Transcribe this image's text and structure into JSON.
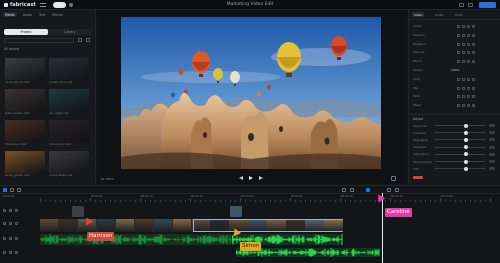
{
  "app": {
    "logo": "fabricast",
    "project_title": "Marketing Video Edit"
  },
  "left_panel": {
    "tabs": [
      "Media",
      "Audio",
      "Text",
      "Effects"
    ],
    "active_tab": 0,
    "segment": {
      "on": "Project",
      "off": "Library"
    },
    "section_title": "All media",
    "thumbs": [
      {
        "caption": "landscape_01.mp4",
        "bg": "#3a3d3f"
      },
      {
        "caption": "sunset_drive.mp4",
        "bg": "#2a2f36"
      },
      {
        "caption": "skate_session.mp4",
        "bg": "#3b3430"
      },
      {
        "caption": "city_night.mp4",
        "bg": "#1e3b40"
      },
      {
        "caption": "interview_a.mp4",
        "bg": "#4a2c24"
      },
      {
        "caption": "interview_b.mp4",
        "bg": "#2a2226"
      },
      {
        "caption": "beach_golden.mp4",
        "bg": "#7a5226"
      },
      {
        "caption": "crowd_street.mp4",
        "bg": "#3c3a3a"
      }
    ]
  },
  "preview": {
    "scale_label": "Fit 100%",
    "accent": "#2f6fd6"
  },
  "right_panel": {
    "tabs": [
      "Video",
      "Audio",
      "Color"
    ],
    "active_tab": 0,
    "props": [
      {
        "key": "Scale",
        "val": ""
      },
      {
        "key": "Position",
        "val": ""
      },
      {
        "key": "Rotation",
        "val": ""
      },
      {
        "key": "Opacity",
        "val": ""
      },
      {
        "key": "Blend",
        "val": ""
      },
      {
        "key": "Speed",
        "val": "100%"
      },
      {
        "key": "Crop",
        "val": ""
      },
      {
        "key": "Flip",
        "val": ""
      },
      {
        "key": "Fade",
        "val": ""
      },
      {
        "key": "Mask",
        "val": ""
      }
    ],
    "adjust_title": "Adjust",
    "sliders": [
      {
        "key": "Exposure",
        "level": 0.62,
        "num": ""
      },
      {
        "key": "Contrast",
        "level": 0.62,
        "num": ""
      },
      {
        "key": "Highlights",
        "level": 0.62,
        "num": ""
      },
      {
        "key": "Shadows",
        "level": 0.62,
        "num": ""
      },
      {
        "key": "Saturation",
        "level": 0.62,
        "num": ""
      },
      {
        "key": "Temperature",
        "level": 0.62,
        "num": ""
      },
      {
        "key": "Tint",
        "level": 0.62,
        "num": ""
      }
    ]
  },
  "timeline": {
    "ruler_labels": [
      "00:00:00",
      "00:00:05",
      "00:00:10",
      "00:00:15",
      "00:00:20",
      "00:00:25",
      "00:00:30",
      "00:00:35",
      "00:00:40"
    ],
    "colors": {
      "video_track": "#4a4030",
      "audio_track": "#1f8a3a",
      "audio_bright": "#2bd14f",
      "selected_outline": "#9fb2c9"
    }
  },
  "collaborators": [
    {
      "name": "Harrison",
      "color": "#d9463b"
    },
    {
      "name": "Simon",
      "color": "#e6a817"
    },
    {
      "name": "Caroline",
      "color": "#e23fa5"
    }
  ]
}
